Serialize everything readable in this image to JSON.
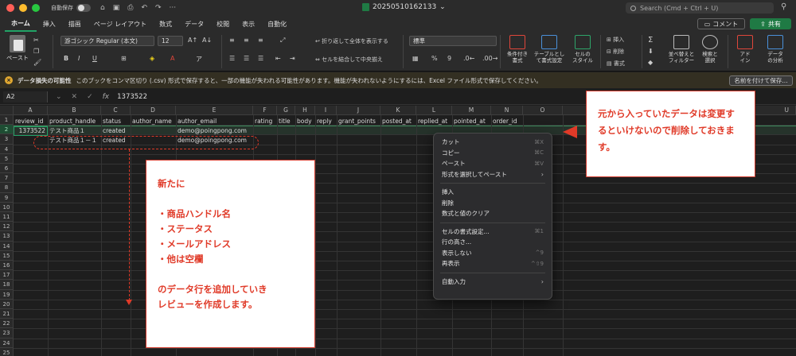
{
  "titlebar": {
    "autosave_label": "自動保存",
    "filename": "20250510162133",
    "search_placeholder": "Search (Cmd + Ctrl + U)"
  },
  "ribbon_tabs": [
    "ホーム",
    "挿入",
    "描画",
    "ページ レイアウト",
    "数式",
    "データ",
    "校閲",
    "表示",
    "自動化"
  ],
  "header_buttons": {
    "comment": "コメント",
    "share": "共有"
  },
  "ribbon": {
    "paste": "ペースト",
    "font_name": "游ゴシック Regular (本文)",
    "font_size": "12",
    "wrap_text": "折り返して全体を表示する",
    "merge_center": "セルを結合して中央揃え",
    "number_format": "標準",
    "conditional_format": "条件付き\n書式",
    "format_as_table": "テーブルとして書式設定",
    "cell_styles": "セルの\nスタイル",
    "insert": "挿入",
    "delete": "削除",
    "format": "書式",
    "sort_filter": "並べ替えと\nフィルター",
    "find_select": "検索と\n選択",
    "addins": "アド\nイン",
    "analyze_data": "データ\nの分析"
  },
  "infobar": {
    "title": "データ損失の可能性",
    "message": "このブックをコンマ区切り (.csv) 形式で保存すると、一部の機能が失われる可能性があります。機能が失われないようにするには、Excel ファイル形式で保存してください。",
    "save_as_button": "名前を付けて保存..."
  },
  "formula_bar": {
    "name_box": "A2",
    "value": "1373522"
  },
  "columns": [
    "A",
    "B",
    "C",
    "D",
    "E",
    "F",
    "G",
    "H",
    "I",
    "J",
    "K",
    "L",
    "M",
    "N",
    "O",
    "U"
  ],
  "rows": [
    "1",
    "2",
    "3",
    "4",
    "5",
    "6",
    "7",
    "8",
    "9",
    "10",
    "11",
    "12",
    "13",
    "14",
    "15",
    "16",
    "17",
    "18",
    "19",
    "20",
    "21",
    "22",
    "23",
    "24",
    "25"
  ],
  "header_row": [
    "review_id",
    "product_handle",
    "status",
    "author_name",
    "author_email",
    "rating",
    "title",
    "body",
    "reply",
    "grant_points",
    "posted_at",
    "replied_at",
    "pointed_at",
    "order_id"
  ],
  "row2": {
    "review_id": "1373522",
    "product_handle": "テスト商品１",
    "status": "created",
    "author_email": "demo@poingpong.com"
  },
  "row3": {
    "product_handle": "テスト商品１－１",
    "status": "created",
    "author_email": "demo@poingpong.com"
  },
  "context_menu": [
    {
      "label": "カット",
      "shortcut": "⌘X"
    },
    {
      "label": "コピー",
      "shortcut": "⌘C"
    },
    {
      "label": "ペースト",
      "shortcut": "⌘V"
    },
    {
      "label": "形式を選択してペースト",
      "submenu": true
    },
    {
      "separator": true
    },
    {
      "label": "挿入"
    },
    {
      "label": "削除"
    },
    {
      "label": "数式と値のクリア"
    },
    {
      "separator": true
    },
    {
      "label": "セルの書式設定...",
      "shortcut": "⌘1"
    },
    {
      "label": "行の高さ..."
    },
    {
      "label": "表示しない",
      "shortcut": "^9"
    },
    {
      "label": "再表示",
      "shortcut": "^⇧9"
    },
    {
      "separator": true
    },
    {
      "label": "自動入力",
      "submenu": true
    }
  ],
  "annotations": {
    "note_left": [
      "新たに",
      "",
      "・商品ハンドル名",
      "・ステータス",
      "・メールアドレス",
      "・他は空欄",
      "",
      "のデータ行を追加していき",
      "レビューを作成します。"
    ],
    "note_right": [
      "元から入っていたデータは",
      "変更するといけないので",
      "削除しておきます。"
    ]
  },
  "colors": {
    "accent_green": "#21a366",
    "annotation_red": "#e03a28"
  }
}
